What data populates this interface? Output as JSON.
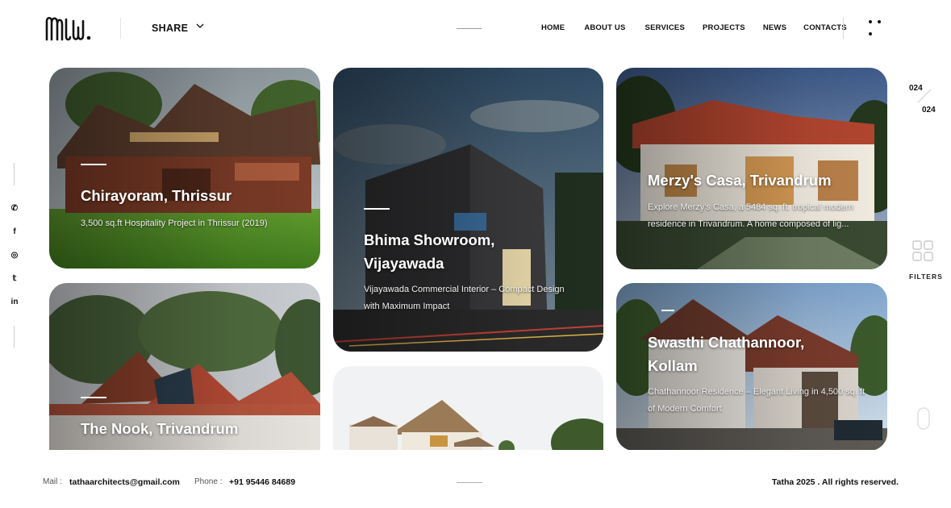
{
  "header": {
    "logo_text": "ᗰᒪᗯ.",
    "share_label": "SHARE",
    "nav": [
      "HOME",
      "ABOUT US",
      "SERVICES",
      "PROJECTS",
      "NEWS",
      "CONTACTS"
    ]
  },
  "social": {
    "icons": [
      "whatsapp-icon",
      "facebook-icon",
      "instagram-icon",
      "twitter-icon",
      "linkedin-icon"
    ],
    "glyphs": [
      "✆",
      "f",
      "◎",
      "𝕥",
      "in"
    ]
  },
  "counter": {
    "current": "024",
    "total": "024"
  },
  "filters": {
    "label": "FILTERS"
  },
  "projects": [
    {
      "title": "Chirayoram, Thrissur",
      "description": "3,500 sq.ft Hospitality Project in Thrissur (2019)"
    },
    {
      "title_line1": "Bhima Showroom,",
      "title_line2": "Vijayawada",
      "description_line1": "Vijayawada Commercial Interior – Compact Design",
      "description_line2": "with Maximum Impact"
    },
    {
      "title": "Merzy's Casa, Trivandrum",
      "description_line1": "Explore Merzy's Casa, a 5484 sq. ft. tropical modern",
      "description_line2": "residence in Trivandrum. A home composed of lig..."
    },
    {
      "title": "The Nook, Trivandrum"
    },
    {
      "title_line1": "Swasthi Chathannoor,",
      "title_line2": "Kollam",
      "description_line1": "Chathannoor Residence – Elegant Living in 4,500 sq. ft",
      "description_line2": "of Modern Comfort"
    },
    {
      "title": ""
    }
  ],
  "footer": {
    "mail_label": "Mail :",
    "mail_value": "tathaarchitects@gmail.com",
    "phone_label": "Phone :",
    "phone_value": "+91 95446 84689",
    "copyright": "Tatha 2025 . All rights reserved."
  },
  "colors": {
    "accent_text": "#111111",
    "background": "#ffffff"
  }
}
